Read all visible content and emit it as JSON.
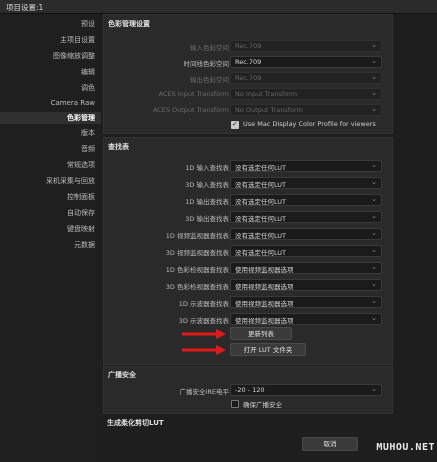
{
  "window": {
    "title": "项目设置:1"
  },
  "sidebar": {
    "items": [
      {
        "label": "预设"
      },
      {
        "label": "主项目设置"
      },
      {
        "label": "图像缩放调整"
      },
      {
        "label": "编辑"
      },
      {
        "label": "调色"
      },
      {
        "label": "Camera Raw"
      },
      {
        "label": "色彩管理"
      },
      {
        "label": "版本"
      },
      {
        "label": "音频"
      },
      {
        "label": "常规选项"
      },
      {
        "label": "采机采集与回放"
      },
      {
        "label": "控制面板"
      },
      {
        "label": "自动保存"
      },
      {
        "label": "键盘映射"
      },
      {
        "label": "元数据"
      }
    ],
    "active_index": 6
  },
  "color_management": {
    "title": "色彩管理设置",
    "rows": [
      {
        "label": "输入色彩空间",
        "value": "Rec.709",
        "disabled": true
      },
      {
        "label": "时间线色彩空间",
        "value": "Rec.709",
        "disabled": false
      },
      {
        "label": "输出色彩空间",
        "value": "Rec.709",
        "disabled": true
      },
      {
        "label": "ACES Input Transform",
        "value": "No Input Transform",
        "disabled": true
      },
      {
        "label": "ACES Output Transform",
        "value": "No Output Transform",
        "disabled": true
      }
    ],
    "mac_profile": {
      "label": "Use Mac Display Color Profile for viewers",
      "checked": true
    }
  },
  "lut": {
    "title": "查找表",
    "rows": [
      {
        "label": "1D 输入查找表",
        "value": "没有选定任何LUT"
      },
      {
        "label": "3D 输入查找表",
        "value": "没有选定任何LUT"
      },
      {
        "label": "1D 输出查找表",
        "value": "没有选定任何LUT"
      },
      {
        "label": "3D 输出查找表",
        "value": "没有选定任何LUT"
      },
      {
        "label": "1D 视频监视器查找表",
        "value": "没有选定任何LUT"
      },
      {
        "label": "3D 视频监视器查找表",
        "value": "没有选定任何LUT"
      },
      {
        "label": "1D 色彩检视器查找表",
        "value": "使用视频监视器选项"
      },
      {
        "label": "3D 色彩检视器查找表",
        "value": "使用视频监视器选项"
      },
      {
        "label": "1D 示波器查找表",
        "value": "使用视频监视器选项"
      },
      {
        "label": "3D 示波器查找表",
        "value": "使用视频监视器选项"
      }
    ],
    "update_list_label": "更新列表",
    "open_folder_label": "打开 LUT 文件夹"
  },
  "broadcast": {
    "title": "广播安全",
    "ire_label": "广播安全IRE电平",
    "ire_value": "-20 - 120",
    "check_label": "确保广播安全",
    "checked": false
  },
  "soft_clip": {
    "title": "生成柔化剪切LUT"
  },
  "footer": {
    "cancel_label": "取消"
  },
  "watermark": "MUHOU.NET",
  "colors": {
    "annotation_arrow": "#e41a1a"
  }
}
